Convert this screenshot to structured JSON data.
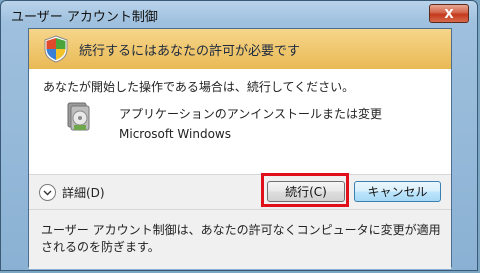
{
  "window": {
    "title": "ユーザー アカウント制御",
    "close_label": "X"
  },
  "banner": {
    "text": "続行するにはあなたの許可が必要です",
    "icon": "uac-shield-icon"
  },
  "body": {
    "instruction": "あなたが開始した操作である場合は、続行してください。",
    "program_name": "アプリケーションのアンインストールまたは変更",
    "publisher": "Microsoft Windows",
    "program_icon": "programs-icon"
  },
  "buttons": {
    "details": "詳細(D)",
    "continue": "続行(C)",
    "cancel": "キャンセル"
  },
  "footer": {
    "text": "ユーザー アカウント制御は、あなたの許可なくコンピュータに変更が適用されるのを防ぎます。"
  },
  "colors": {
    "highlight": "#e0101a",
    "banner": "#f2cc74"
  }
}
